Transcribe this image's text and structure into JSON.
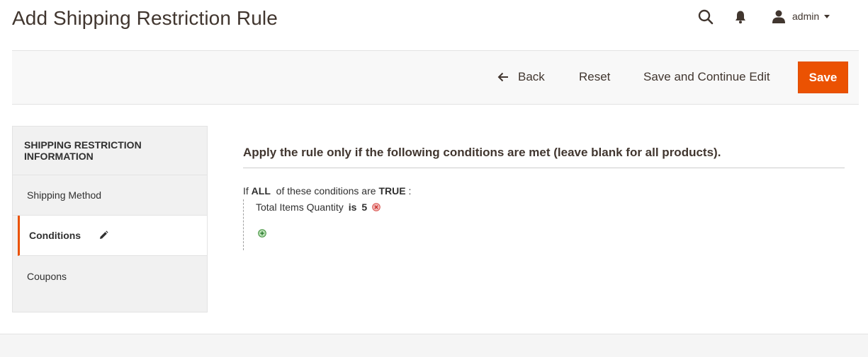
{
  "page": {
    "title": "Add Shipping Restriction Rule"
  },
  "header": {
    "user_name": "admin"
  },
  "toolbar": {
    "back_label": "Back",
    "reset_label": "Reset",
    "save_continue_label": "Save and Continue Edit",
    "save_label": "Save"
  },
  "sidebar": {
    "title": "Shipping Restriction Information",
    "items": [
      {
        "label": "Shipping Method"
      },
      {
        "label": "Conditions"
      },
      {
        "label": "Coupons"
      }
    ]
  },
  "conditions": {
    "heading": "Apply the rule only if the following conditions are met (leave blank for all products).",
    "prefix": "If",
    "aggregator": "ALL",
    "middle": "of these conditions are",
    "value": "TRUE",
    "suffix": ":",
    "rules": [
      {
        "attribute": "Total Items Quantity",
        "operator": "is",
        "value": "5"
      }
    ]
  },
  "colors": {
    "accent": "#eb5202",
    "text": "#41362f"
  }
}
